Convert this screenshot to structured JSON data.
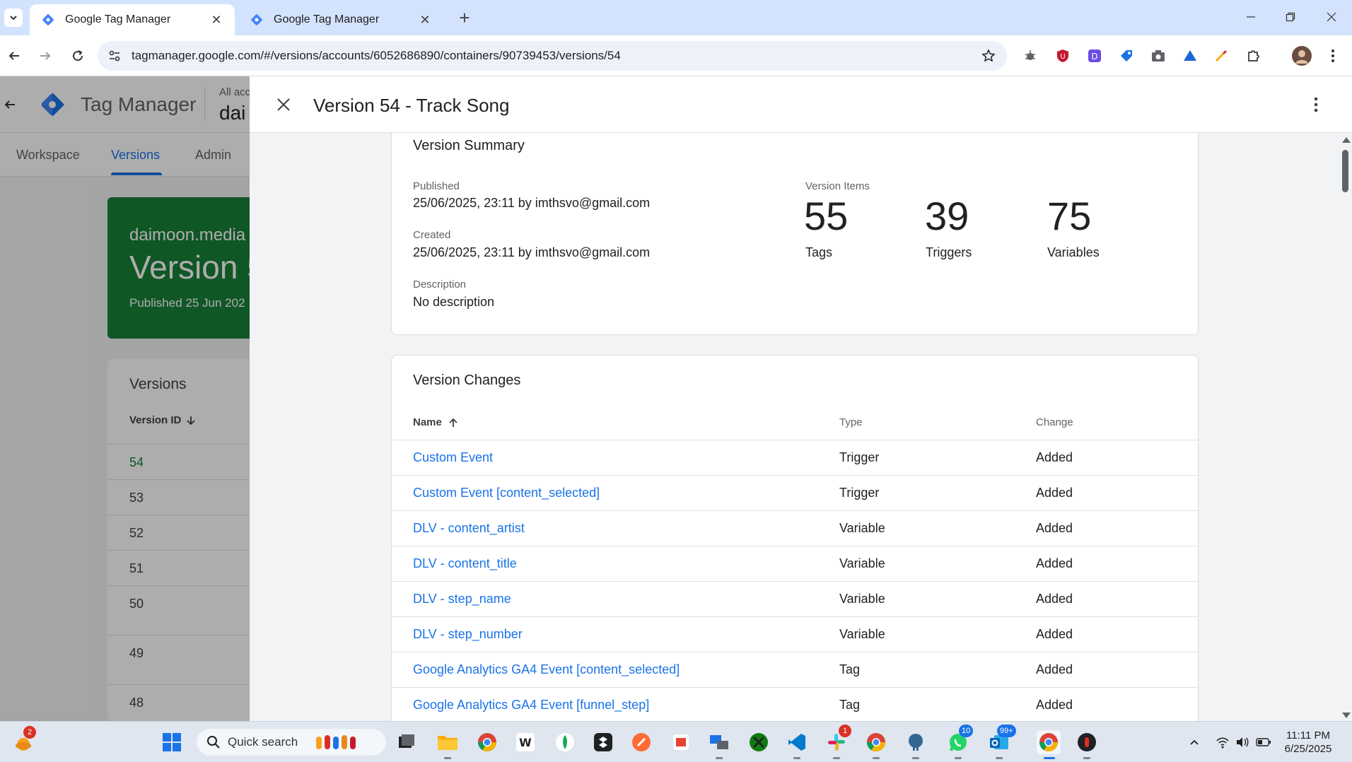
{
  "browser": {
    "tabs": [
      {
        "title": "Google Tag Manager",
        "active": true
      },
      {
        "title": "Google Tag Manager",
        "active": false
      }
    ],
    "url": "tagmanager.google.com/#/versions/accounts/6052686890/containers/90739453/versions/54"
  },
  "app": {
    "product_name": "Tag Manager",
    "account_small": "All acc",
    "account_big": "dai",
    "nav": [
      "Workspace",
      "Versions",
      "Admin"
    ],
    "green_card": {
      "account": "daimoon.media",
      "version": "Version 5",
      "published": "Published 25 Jun 202"
    },
    "versions_list": {
      "title": "Versions",
      "column": "Version ID",
      "ids": [
        "54",
        "53",
        "52",
        "51",
        "50",
        "49",
        "48"
      ]
    }
  },
  "panel": {
    "title": "Version 54 - Track Song",
    "summary": {
      "title": "Version Summary",
      "published_label": "Published",
      "published_value": "25/06/2025, 23:11 by imthsvo@gmail.com",
      "created_label": "Created",
      "created_value": "25/06/2025, 23:11 by imthsvo@gmail.com",
      "description_label": "Description",
      "description_value": "No description",
      "items_label": "Version Items",
      "stats": [
        {
          "value": "55",
          "label": "Tags"
        },
        {
          "value": "39",
          "label": "Triggers"
        },
        {
          "value": "75",
          "label": "Variables"
        }
      ]
    },
    "changes": {
      "title": "Version Changes",
      "headers": {
        "name": "Name",
        "type": "Type",
        "change": "Change"
      },
      "rows": [
        {
          "name": "Custom Event",
          "type": "Trigger",
          "change": "Added"
        },
        {
          "name": "Custom Event [content_selected]",
          "type": "Trigger",
          "change": "Added"
        },
        {
          "name": "DLV - content_artist",
          "type": "Variable",
          "change": "Added"
        },
        {
          "name": "DLV - content_title",
          "type": "Variable",
          "change": "Added"
        },
        {
          "name": "DLV - step_name",
          "type": "Variable",
          "change": "Added"
        },
        {
          "name": "DLV - step_number",
          "type": "Variable",
          "change": "Added"
        },
        {
          "name": "Google Analytics GA4 Event [content_selected]",
          "type": "Tag",
          "change": "Added"
        },
        {
          "name": "Google Analytics GA4 Event [funnel_step]",
          "type": "Tag",
          "change": "Added"
        }
      ]
    }
  },
  "taskbar": {
    "search_placeholder": "Quick search",
    "badges": {
      "weather": "2",
      "slack": "1",
      "whatsapp": "10",
      "outlook": "99+"
    },
    "time": "11:11 PM",
    "date": "6/25/2025"
  },
  "colors": {
    "accent": "#1a73e8",
    "published_green": "#188038",
    "tab_strip": "#d3e3fd"
  }
}
